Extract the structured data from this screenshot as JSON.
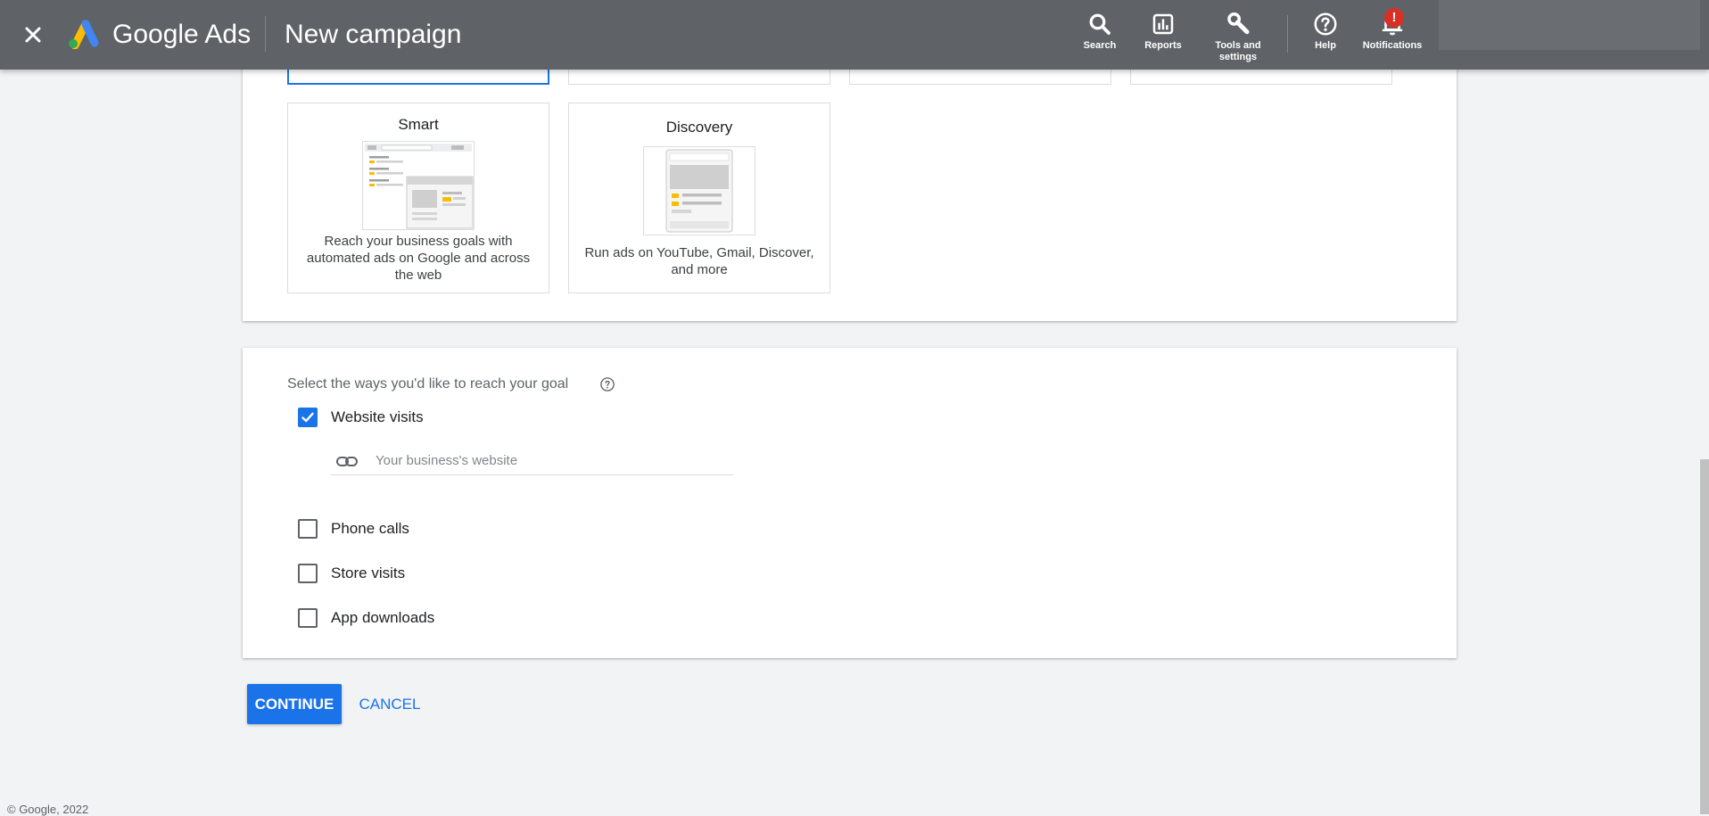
{
  "header": {
    "brand": "Google Ads",
    "title": "New campaign",
    "nav": [
      {
        "label": "Search",
        "icon": "search-icon"
      },
      {
        "label": "Reports",
        "icon": "reports-icon"
      },
      {
        "label": "Tools and settings",
        "icon": "wrench-icon"
      },
      {
        "label": "Help",
        "icon": "help-icon"
      },
      {
        "label": "Notifications",
        "icon": "bell-icon",
        "badge": "!"
      }
    ]
  },
  "campaign_types": [
    {
      "title": "Smart",
      "description": "Reach your business goals with automated ads on Google and across the web"
    },
    {
      "title": "Discovery",
      "description": "Run ads on YouTube, Gmail, Discover, and more"
    }
  ],
  "goals": {
    "label": "Select the ways you'd like to reach your goal",
    "options": [
      {
        "label": "Website visits",
        "checked": true
      },
      {
        "label": "Phone calls",
        "checked": false
      },
      {
        "label": "Store visits",
        "checked": false
      },
      {
        "label": "App downloads",
        "checked": false
      }
    ],
    "website_placeholder": "Your business's website"
  },
  "actions": {
    "continue": "CONTINUE",
    "cancel": "CANCEL"
  },
  "footer": "© Google, 2022",
  "colors": {
    "accent": "#1a73e8",
    "header": "#5f6368",
    "badge": "#d93025"
  }
}
